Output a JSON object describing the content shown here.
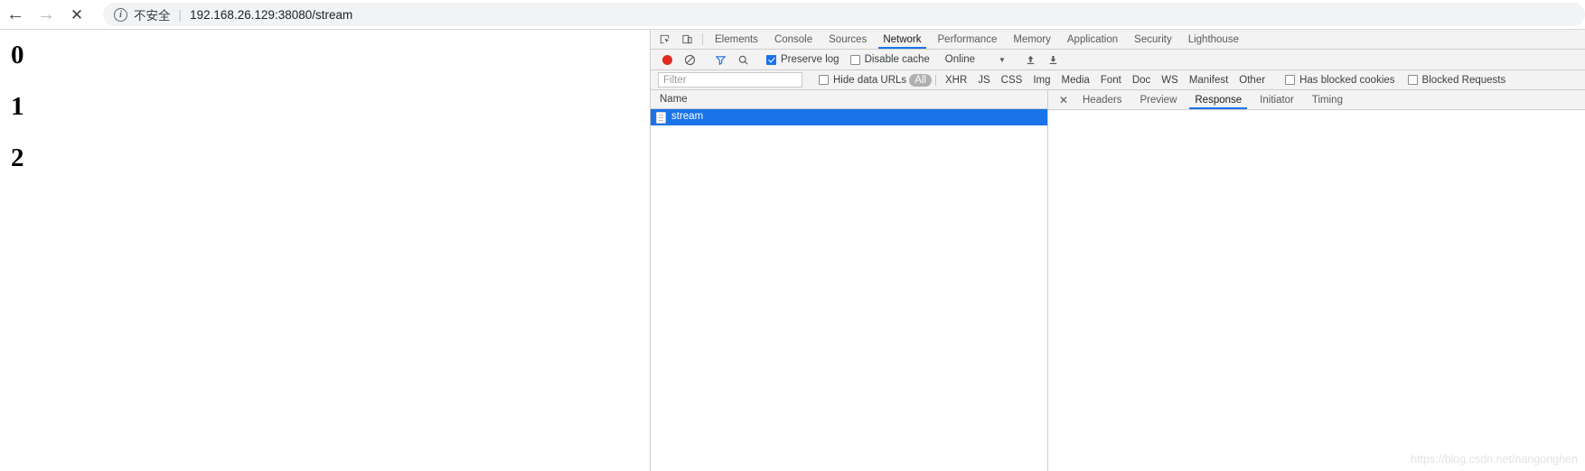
{
  "browser": {
    "back_icon": "arrow-left-icon",
    "forward_icon": "arrow-right-icon",
    "stop_icon": "close-x-icon",
    "security_icon": "info-circle-icon",
    "security_label": "不安全",
    "separator": "|",
    "url": "192.168.26.129:38080/stream"
  },
  "page": {
    "lines": [
      "0",
      "1",
      "2"
    ]
  },
  "devtools": {
    "inspect_icon": "inspect-cursor-icon",
    "device_icon": "device-toolbar-icon",
    "tabs": [
      {
        "label": "Elements",
        "active": false
      },
      {
        "label": "Console",
        "active": false
      },
      {
        "label": "Sources",
        "active": false
      },
      {
        "label": "Network",
        "active": true
      },
      {
        "label": "Performance",
        "active": false
      },
      {
        "label": "Memory",
        "active": false
      },
      {
        "label": "Application",
        "active": false
      },
      {
        "label": "Security",
        "active": false
      },
      {
        "label": "Lighthouse",
        "active": false
      }
    ],
    "toolbar": {
      "record_icon": "record-circle-icon",
      "clear_icon": "clear-prohibited-icon",
      "filter_icon": "funnel-filter-icon",
      "search_icon": "magnifier-search-icon",
      "preserve_log_label": "Preserve log",
      "preserve_log_checked": true,
      "disable_cache_label": "Disable cache",
      "disable_cache_checked": false,
      "throttle_value": "Online",
      "throttle_caret": "▼",
      "import_icon": "import-har-up-arrow-icon",
      "export_icon": "export-har-down-arrow-icon"
    },
    "filter_row": {
      "filter_placeholder": "Filter",
      "filter_value": "",
      "hide_data_urls_label": "Hide data URLs",
      "hide_data_urls_checked": false,
      "types": [
        {
          "label": "All",
          "selected": true
        },
        {
          "label": "XHR",
          "selected": false
        },
        {
          "label": "JS",
          "selected": false
        },
        {
          "label": "CSS",
          "selected": false
        },
        {
          "label": "Img",
          "selected": false
        },
        {
          "label": "Media",
          "selected": false
        },
        {
          "label": "Font",
          "selected": false
        },
        {
          "label": "Doc",
          "selected": false
        },
        {
          "label": "WS",
          "selected": false
        },
        {
          "label": "Manifest",
          "selected": false
        },
        {
          "label": "Other",
          "selected": false
        }
      ],
      "has_blocked_cookies_label": "Has blocked cookies",
      "has_blocked_cookies_checked": false,
      "blocked_requests_label": "Blocked Requests",
      "blocked_requests_checked": false
    },
    "request_list": {
      "column_name": "Name",
      "rows": [
        {
          "name": "stream",
          "icon": "document-file-icon",
          "selected": true
        }
      ]
    },
    "detail_pane": {
      "close_icon": "close-x-icon",
      "tabs": [
        {
          "label": "Headers",
          "active": false
        },
        {
          "label": "Preview",
          "active": false
        },
        {
          "label": "Response",
          "active": true
        },
        {
          "label": "Initiator",
          "active": false
        },
        {
          "label": "Timing",
          "active": false
        }
      ],
      "content": ""
    }
  },
  "watermark": "https://blog.csdn.net/nangonghen",
  "colors": {
    "accent": "#1a73e8",
    "record": "#e02a20",
    "toolbar_bg": "#f3f3f3",
    "selected_row": "#1a73e8"
  }
}
